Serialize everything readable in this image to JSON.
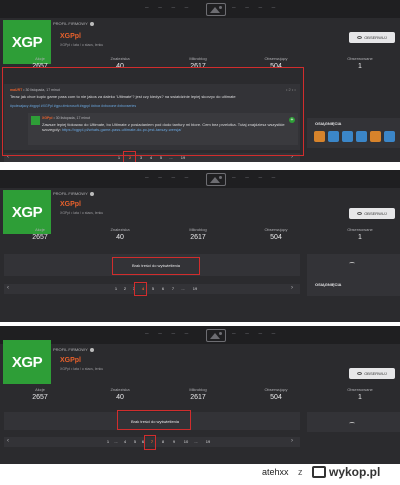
{
  "profile": {
    "logo_text": "XGP",
    "tag": "PROFIL FIRMOWY",
    "name": "XGPpl",
    "subtitle": "XGPpl • lata / o stacs, lenku",
    "follow_label": "OBSERWUJ"
  },
  "stats": {
    "labels": [
      "Akcje",
      "Znaleziska",
      "Mikroblog",
      "Obserwujący",
      "Obserwowane"
    ],
    "values": [
      "2657",
      "40",
      "2617",
      "504",
      "1"
    ]
  },
  "entry": {
    "author": "maURT",
    "time": "• 30 listopada, 17 minut",
    "text": "Teraz jak chce kupic game pass com to nie jakos za daleko 'Ultimate'? jest czy kiedys? na swiatdzinie lepiej skorzyc do ultimate",
    "tags": "#polecajacy #xgppl #XGPpl #gpu #microsoft #xgppl #xbox #xboxone #xboxseries",
    "tools": "• 2 • •",
    "comment_author": "XGPpl",
    "comment_time": "• 30 listopada, 17 minut",
    "comment_text": "Zawsze lepiej tlokowac do Ultimate, bo Ultimate z posiadaniem pod dodo tanfury mi biore. Cem bez przelotka. Tutaj znajdziesz wszystkie szczegoly:",
    "comment_link": "https://xgppl.pl/whats-game-pass-ultimate-do-pc-jest-tanszy-wersja/"
  },
  "sidebar": {
    "title": "OSIĄGNIĘCIA"
  },
  "no_content": "Brak treści do wyświetlenia",
  "pagers": [
    {
      "pages": [
        "1",
        "2",
        "3",
        "4",
        "5",
        "...",
        "19"
      ],
      "current": "2"
    },
    {
      "pages": [
        "1",
        "2",
        "3",
        "4",
        "5",
        "6",
        "7",
        "...",
        "19"
      ],
      "current": "4"
    },
    {
      "pages": [
        "1",
        "...",
        "4",
        "5",
        "6",
        "7",
        "8",
        "9",
        "10",
        "...",
        "19"
      ],
      "current": "7"
    }
  ],
  "footer": {
    "user": "atehxx",
    "z": "z",
    "site": "wykop.pl"
  },
  "colors": {
    "accent": "#e8612c",
    "brand_green": "#2e9e37",
    "highlight": "#d12d2d",
    "panel_bg": "#2b2b2e"
  }
}
